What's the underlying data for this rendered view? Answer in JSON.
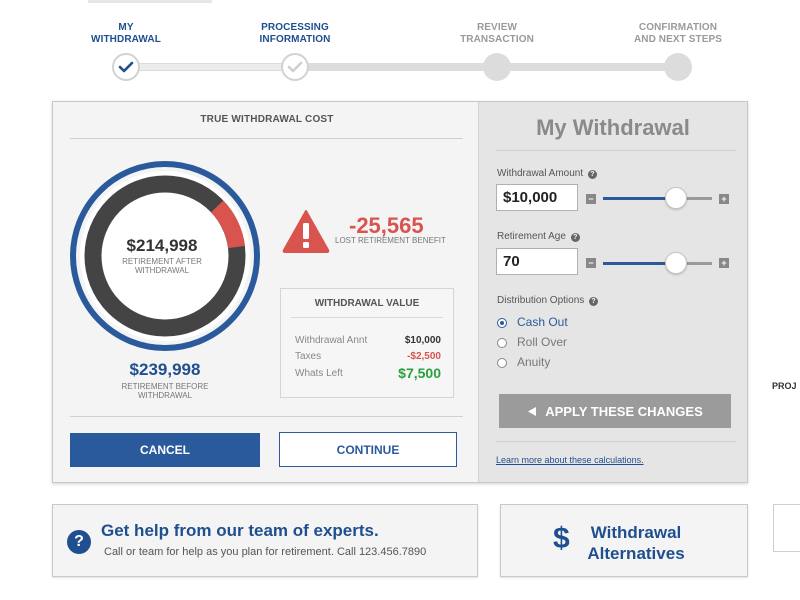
{
  "stepper": {
    "steps": [
      {
        "label": "MY\nWITHDRAWAL",
        "state": "active"
      },
      {
        "label": "PROCESSING\nINFORMATION",
        "state": "active"
      },
      {
        "label": "REVIEW\nTRANSACTION",
        "state": "pending"
      },
      {
        "label": "CONFIRMATION\nAND NEXT STEPS",
        "state": "pending"
      }
    ]
  },
  "cost": {
    "title": "TRUE WITHDRAWAL COST",
    "after_amount": "$214,998",
    "after_label": "RETIREMENT AFTER WITHDRAWAL",
    "before_amount": "$239,998",
    "before_label": "RETIREMENT BEFORE WITHDRAWAL",
    "lost_amount": "-25,565",
    "lost_label": "LOST RETIREMENT BENEFIT",
    "withdrawal_value": {
      "title": "WITHDRAWAL VALUE",
      "rows": [
        {
          "label": "Withdrawal Annt",
          "value": "$10,000",
          "tone": "normal"
        },
        {
          "label": "Taxes",
          "value": "-$2,500",
          "tone": "red"
        },
        {
          "label": "Whats Left",
          "value": "$7,500",
          "tone": "green"
        }
      ]
    },
    "cancel_label": "CANCEL",
    "continue_label": "CONTINUE"
  },
  "panel": {
    "title": "My Withdrawal",
    "amount_label": "Withdrawal Amount",
    "amount_value": "$10,000",
    "amount_level": 0.67,
    "age_label": "Retirement Age",
    "age_value": "70",
    "age_level": 0.67,
    "help_glyph": "?",
    "minus_glyph": "−",
    "plus_glyph": "+",
    "distribution_label": "Distribution Options",
    "options": [
      {
        "label": "Cash Out",
        "selected": true
      },
      {
        "label": "Roll Over",
        "selected": false
      },
      {
        "label": "Anuity",
        "selected": false
      }
    ],
    "apply_label": "APPLY THESE CHANGES",
    "learn_link": "Learn more about these calculations."
  },
  "help_card": {
    "title": "Get help from our team of experts.",
    "subtitle": "Call or team for help as you plan for retirement. Call 123.456.7890",
    "icon_glyph": "?"
  },
  "alt_card": {
    "icon_glyph": "$",
    "title": "Withdrawal Alternatives"
  },
  "side": {
    "proj_label": "PROJ"
  },
  "colors": {
    "brand_blue": "#2b5a9c",
    "danger_red": "#d9534f",
    "success_green": "#2aa03f",
    "donut_dark": "#444444"
  },
  "icons": [
    "check-icon",
    "warning-icon",
    "help-icon",
    "dollar-icon",
    "play-left-icon",
    "minus-icon",
    "plus-icon"
  ]
}
